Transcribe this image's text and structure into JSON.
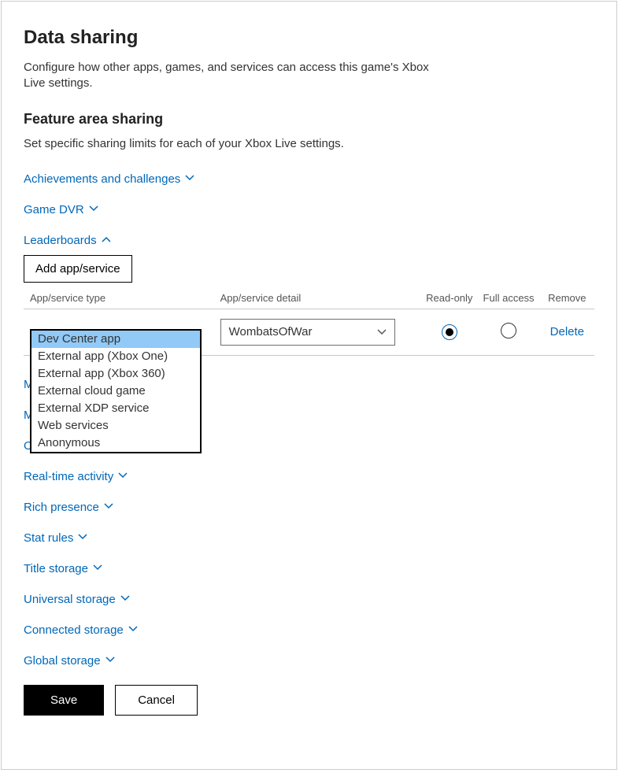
{
  "page": {
    "title": "Data sharing",
    "description": "Configure how other apps, games, and services can access this game's Xbox Live settings."
  },
  "section": {
    "title": "Feature area sharing",
    "description": "Set specific sharing limits for each of your Xbox Live settings."
  },
  "features": {
    "achievements": "Achievements and challenges",
    "game_dvr": "Game DVR",
    "leaderboards": "Leaderboards",
    "matchmaking": "M",
    "multiplayer": "M",
    "open_stats": "Open stats",
    "real_time_activity": "Real-time activity",
    "rich_presence": "Rich presence",
    "stat_rules": "Stat rules",
    "title_storage": "Title storage",
    "universal_storage": "Universal storage",
    "connected_storage": "Connected storage",
    "global_storage": "Global storage"
  },
  "leaderboards_panel": {
    "add_button": "Add app/service",
    "headers": {
      "type": "App/service type",
      "detail": "App/service detail",
      "read_only": "Read-only",
      "full_access": "Full access",
      "remove": "Remove"
    },
    "row": {
      "type_selected": "Dev Center app",
      "detail_value": "WombatsOfWar",
      "access": "read-only",
      "delete": "Delete"
    },
    "type_options": [
      "Dev Center app",
      "External app (Xbox One)",
      "External app (Xbox 360)",
      "External cloud game",
      "External XDP service",
      "Web services",
      "Anonymous"
    ]
  },
  "buttons": {
    "save": "Save",
    "cancel": "Cancel"
  }
}
